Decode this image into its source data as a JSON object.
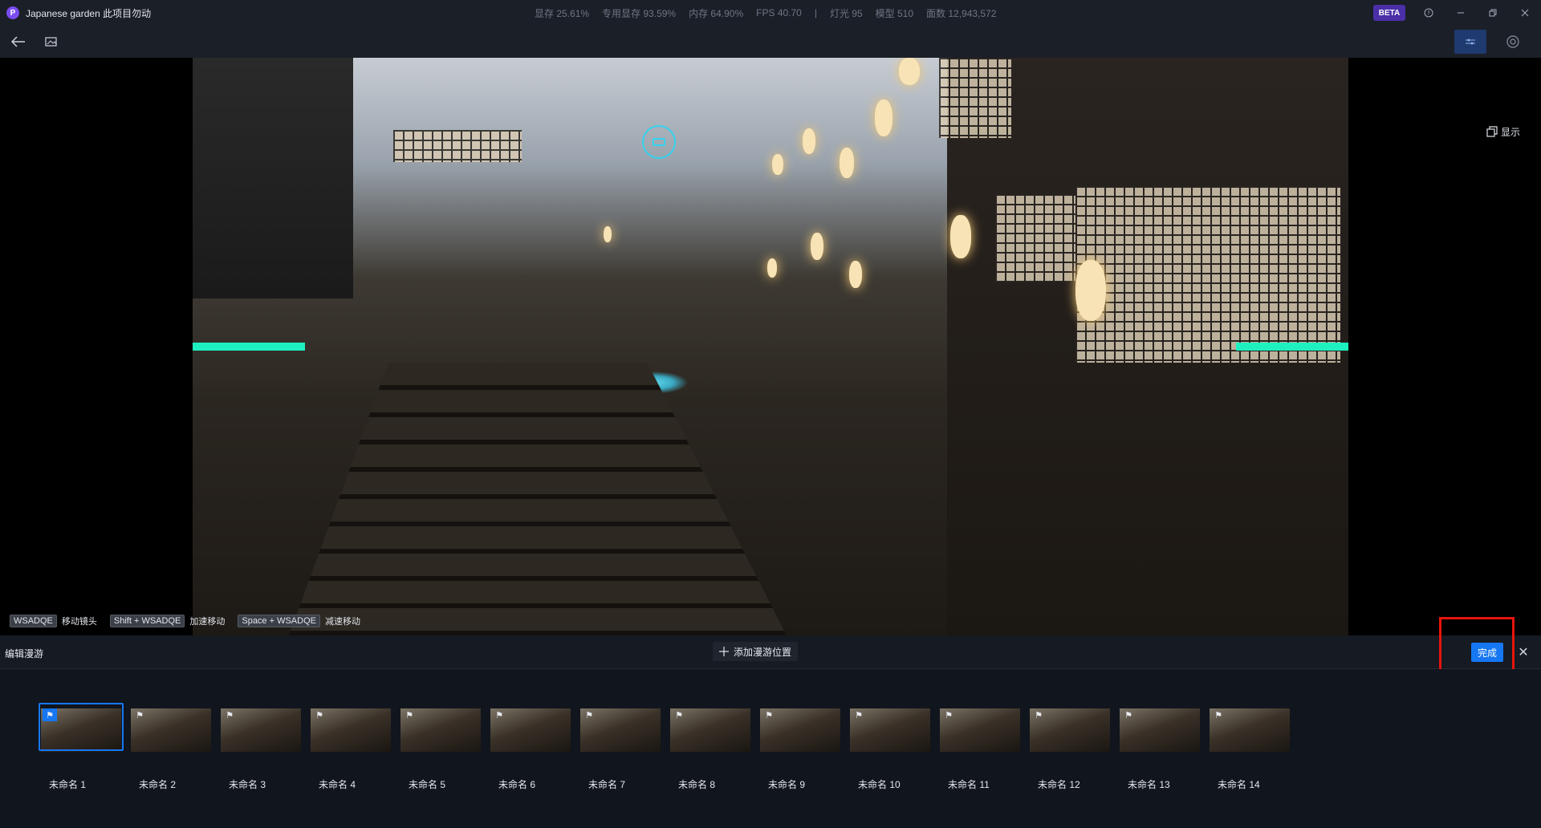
{
  "titlebar": {
    "app_logo_letter": "P",
    "title": "Japanese garden 此项目勿动",
    "stats": [
      "显存 25.61%",
      "专用显存 93.59%",
      "内存 64.90%",
      "FPS 40.70",
      "|",
      "灯光 95",
      "模型 510",
      "面数 12,943,572"
    ],
    "beta": "BETA",
    "icons": [
      "help-icon",
      "minimize-icon",
      "restore-icon",
      "close-icon"
    ]
  },
  "toolbar": {
    "back_icon": "←",
    "image_icon": "image-icon"
  },
  "viewport": {
    "display_label": "显示",
    "hints": [
      {
        "key": "WSADQE",
        "label": "移动镜头"
      },
      {
        "key": "Shift + WSADQE",
        "label": "加速移动"
      },
      {
        "key": "Space + WSADQE",
        "label": "减速移动"
      }
    ]
  },
  "panel": {
    "title": "编辑漫游",
    "add_position": "添加漫游位置",
    "done": "完成",
    "close": "✕"
  },
  "thumbnails": [
    {
      "label": "未命名 1",
      "active": true
    },
    {
      "label": "未命名 2"
    },
    {
      "label": "未命名 3"
    },
    {
      "label": "未命名 4"
    },
    {
      "label": "未命名 5"
    },
    {
      "label": "未命名 6"
    },
    {
      "label": "未命名 7"
    },
    {
      "label": "未命名 8"
    },
    {
      "label": "未命名 9"
    },
    {
      "label": "未命名 10"
    },
    {
      "label": "未命名 11"
    },
    {
      "label": "未命名 12"
    },
    {
      "label": "未命名 13"
    },
    {
      "label": "未命名 14"
    }
  ],
  "colors": {
    "accent": "#1677f2",
    "highlight": "#e8140c",
    "marker": "#1ff0c0"
  }
}
